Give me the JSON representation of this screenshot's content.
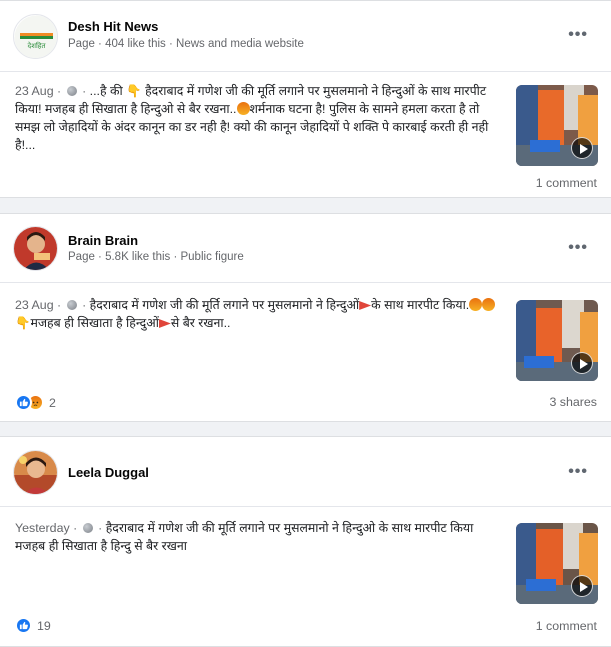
{
  "posts": [
    {
      "page_name": "Desh Hit News",
      "page_meta": "Page · 404 like this · News and media website",
      "avatar_text": "देशहित",
      "date": "23 Aug",
      "text_a": "...है की ",
      "text_b": "हैदराबाद में गणेश जी की मूर्ति लगाने पर मुसलमानो ने हिन्दुओं के साथ मारपीट किया! मजहब ही सिखाता है हिन्दुओ से बैर रखना..",
      "text_c": "शर्मनाक घटना है! पुलिस के सामने हमला करता है तो समझ लो जेहादियों के अंदर कानून का डर नही है! क्यो की कानून जेहादियों पे शक्ति पे कारबाई करती ही नही है!...",
      "footer_right": "1 comment"
    },
    {
      "page_name": "Brain Brain",
      "page_meta": "Page · 5.8K like this · Public figure",
      "date": "23 Aug",
      "text_a": "हैदराबाद में गणेश जी की मूर्ति लगाने पर मुसलमानो ने हिन्दुओं",
      "text_b": "के साथ मारपीट किया.",
      "text_c": "मजहब ही सिखाता है हिन्दुओं",
      "text_d": "से बैर रखना..",
      "reaction_count": "2",
      "footer_right": "3 shares"
    },
    {
      "page_name": "Leela Duggal",
      "date": "Yesterday",
      "text_a": "हैदराबाद में गणेश जी की मूर्ति लगाने पर मुसलमानो ने हिन्दुओ के साथ मारपीट किया मजहब ही सिखाता है हिन्दु से बैर रखना",
      "reaction_count": "19",
      "footer_right": "1 comment"
    }
  ],
  "icons": {
    "more": "more-options-icon",
    "privacy": "globe-icon",
    "play": "play-icon",
    "like": "like-reaction-icon",
    "angry": "angry-reaction-icon"
  },
  "colors": {
    "background": "#f0f2f5",
    "like_blue": "#1877f2",
    "muted_text": "#65676b"
  }
}
